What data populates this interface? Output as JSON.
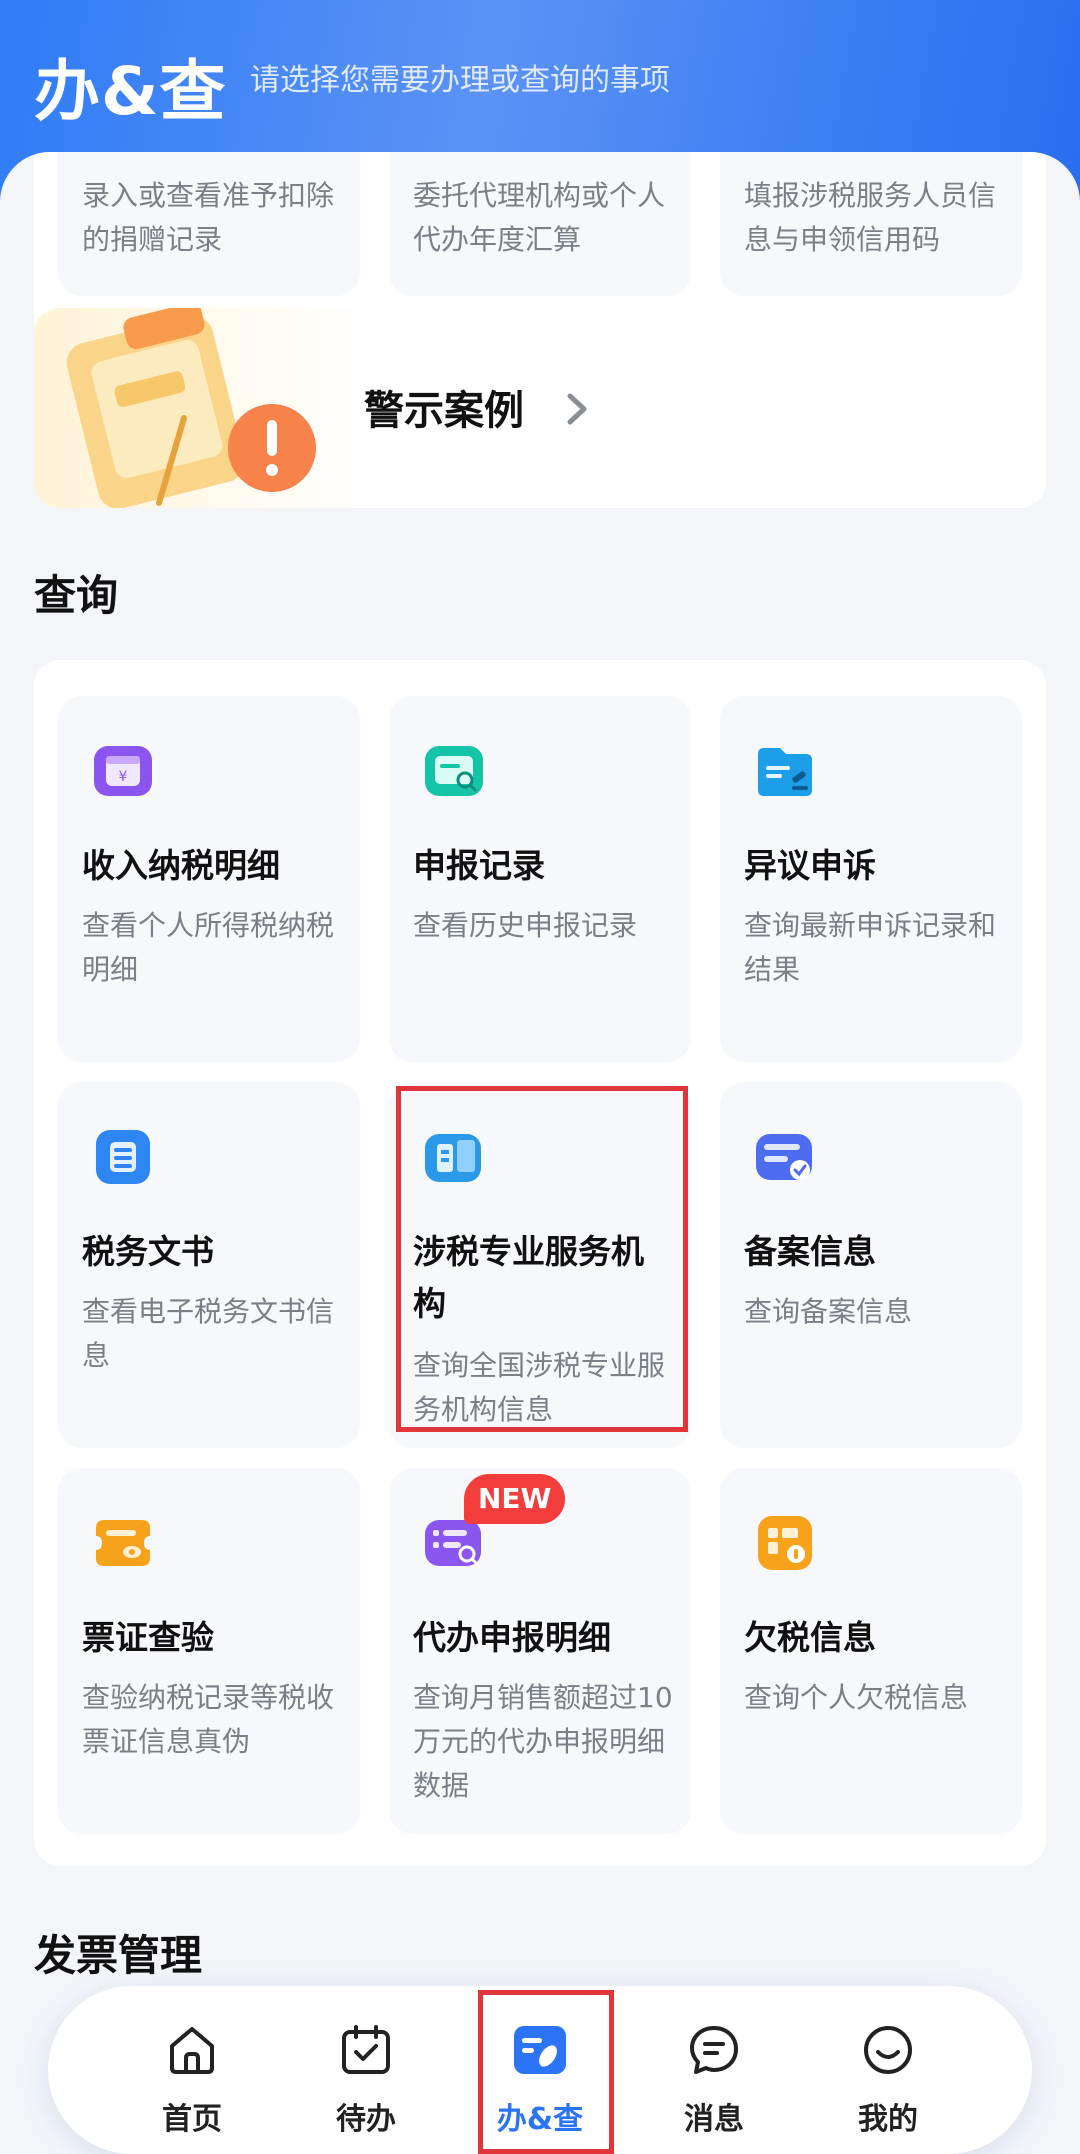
{
  "header": {
    "title": "办&查",
    "subtitle": "请选择您需要办理或查询的事项"
  },
  "top_cards": [
    {
      "desc": "录入或查看准予扣除的捐赠记录"
    },
    {
      "desc": "委托代理机构或个人代办年度汇算"
    },
    {
      "desc": "填报涉税服务人员信息与申领信用码"
    }
  ],
  "warning_banner": {
    "label": "警示案例",
    "icon": "chevron-right-icon"
  },
  "query_section": {
    "title": "查询",
    "cards": [
      {
        "title": "收入纳税明细",
        "desc": "查看个人所得税纳税明细",
        "icon": "income-tax-icon",
        "color": "#8b55f0"
      },
      {
        "title": "申报记录",
        "desc": "查看历史申报记录",
        "icon": "declaration-record-icon",
        "color": "#14c4a6"
      },
      {
        "title": "异议申诉",
        "desc": "查询最新申诉记录和结果",
        "icon": "appeal-icon",
        "color": "#1c9ee8"
      },
      {
        "title": "税务文书",
        "desc": "查看电子税务文书信息",
        "icon": "tax-document-icon",
        "color": "#2d86f2"
      },
      {
        "title": "涉税专业服务机构",
        "desc": "查询全国涉税专业服务机构信息",
        "icon": "service-agency-icon",
        "color": "#2a9ae8"
      },
      {
        "title": "备案信息",
        "desc": "查询备案信息",
        "icon": "filing-info-icon",
        "color": "#4d6cf0"
      },
      {
        "title": "票证查验",
        "desc": "查验纳税记录等税收票证信息真伪",
        "icon": "ticket-verify-icon",
        "color": "#f7a21b"
      },
      {
        "title": "代办申报明细",
        "desc": "查询月销售额超过10万元的代办申报明细数据",
        "icon": "agent-declaration-icon",
        "color": "#8b55f0",
        "badge": "NEW"
      },
      {
        "title": "欠税信息",
        "desc": "查询个人欠税信息",
        "icon": "tax-arrears-icon",
        "color": "#f7a21b"
      }
    ]
  },
  "invoice_section": {
    "title": "发票管理"
  },
  "tabbar": {
    "items": [
      {
        "label": "首页",
        "icon": "home-icon"
      },
      {
        "label": "待办",
        "icon": "todo-icon"
      },
      {
        "label": "办&查",
        "icon": "handle-query-icon",
        "active": true
      },
      {
        "label": "消息",
        "icon": "message-icon"
      },
      {
        "label": "我的",
        "icon": "profile-icon"
      }
    ]
  },
  "colors": {
    "accent": "#2a74f5",
    "highlight_border": "#e0363b",
    "badge": "#f33c3c"
  }
}
